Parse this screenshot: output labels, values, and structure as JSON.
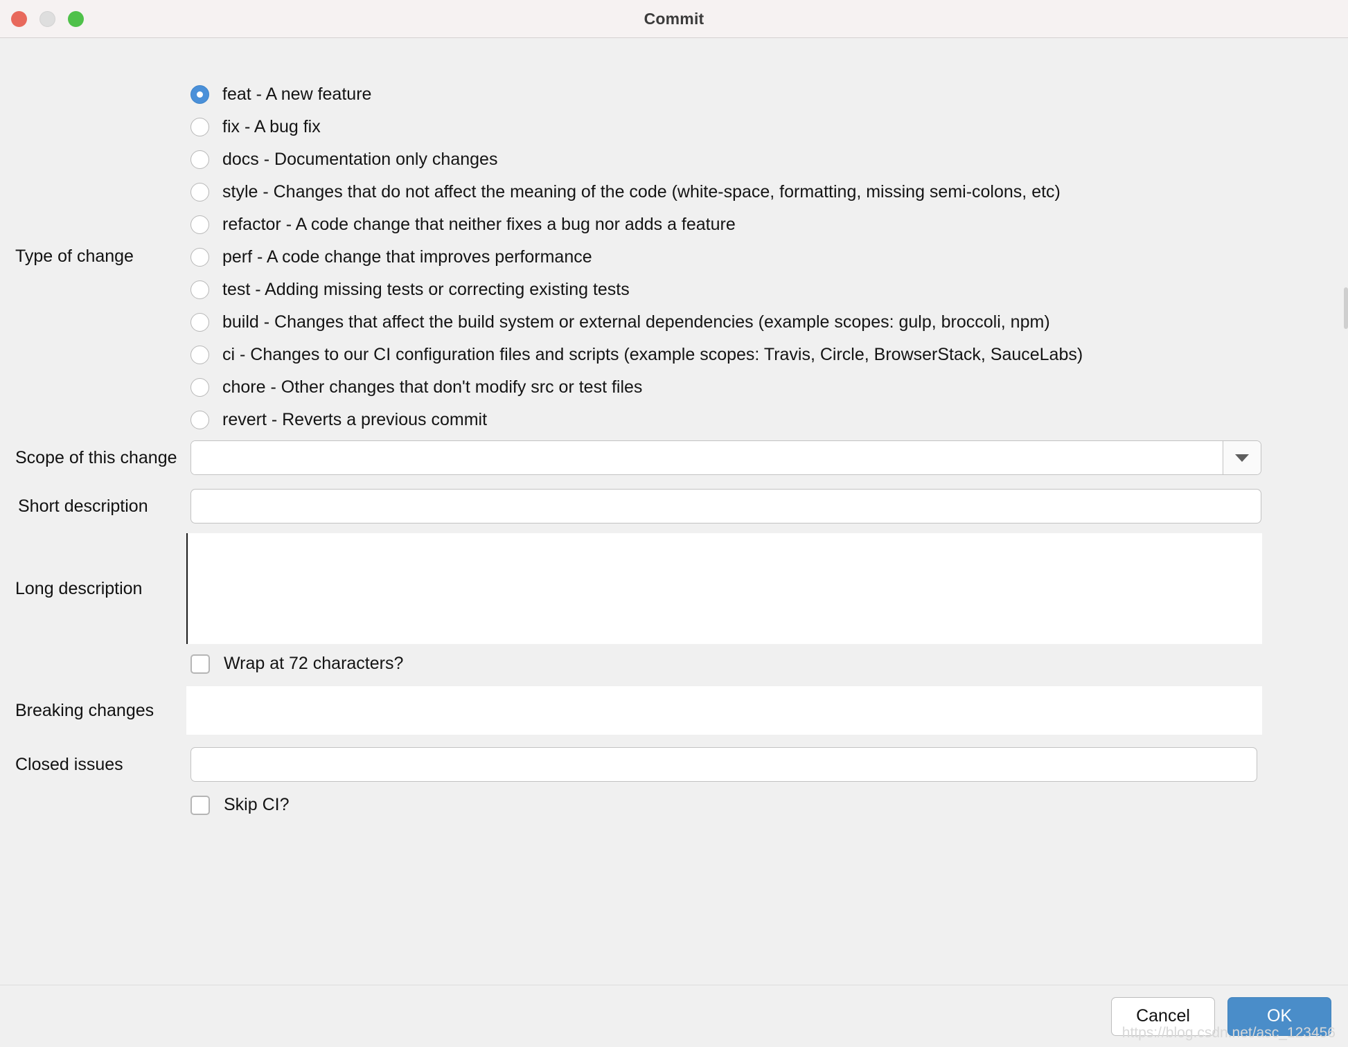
{
  "window": {
    "title": "Commit",
    "traffic_lights": [
      "close",
      "minimize",
      "zoom"
    ]
  },
  "form": {
    "type_label": "Type of change",
    "types": [
      {
        "value": "feat",
        "label": "feat - A new feature",
        "selected": true
      },
      {
        "value": "fix",
        "label": "fix - A bug fix",
        "selected": false
      },
      {
        "value": "docs",
        "label": "docs - Documentation only changes",
        "selected": false
      },
      {
        "value": "style",
        "label": "style - Changes that do not affect the meaning of the code (white-space, formatting, missing semi-colons, etc)",
        "selected": false
      },
      {
        "value": "refactor",
        "label": "refactor - A code change that neither fixes a bug nor adds a feature",
        "selected": false
      },
      {
        "value": "perf",
        "label": "perf - A code change that improves performance",
        "selected": false
      },
      {
        "value": "test",
        "label": "test - Adding missing tests or correcting existing tests",
        "selected": false
      },
      {
        "value": "build",
        "label": "build - Changes that affect the build system or external dependencies (example scopes: gulp, broccoli, npm)",
        "selected": false
      },
      {
        "value": "ci",
        "label": "ci - Changes to our CI configuration files and scripts (example scopes: Travis, Circle, BrowserStack, SauceLabs)",
        "selected": false
      },
      {
        "value": "chore",
        "label": "chore - Other changes that don't modify src or test files",
        "selected": false
      },
      {
        "value": "revert",
        "label": "revert - Reverts a previous commit",
        "selected": false
      }
    ],
    "scope_label": "Scope of this change",
    "scope_value": "",
    "scope_placeholder": "",
    "short_description_label": "Short description",
    "short_description_value": "",
    "short_description_placeholder": "",
    "long_description_label": "Long description",
    "long_description_value": "",
    "long_description_placeholder": "",
    "wrap_label": "Wrap at 72 characters?",
    "wrap_checked": false,
    "breaking_label": "Breaking changes",
    "breaking_value": "",
    "breaking_placeholder": "",
    "closed_issues_label": "Closed issues",
    "closed_issues_value": "",
    "closed_issues_placeholder": "",
    "skip_ci_label": "Skip CI?",
    "skip_ci_checked": false
  },
  "footer": {
    "cancel_label": "Cancel",
    "ok_label": "OK"
  },
  "watermark": "https://blog.csdn.net/asc_123456",
  "colors": {
    "accent": "#4a8dc9",
    "radio_selected": "#4a90d9",
    "titlebar": "#f6f2f2",
    "background": "#f0f0f0",
    "close": "#e8695c",
    "minimize": "#dedede",
    "zoom": "#4fc14a"
  }
}
